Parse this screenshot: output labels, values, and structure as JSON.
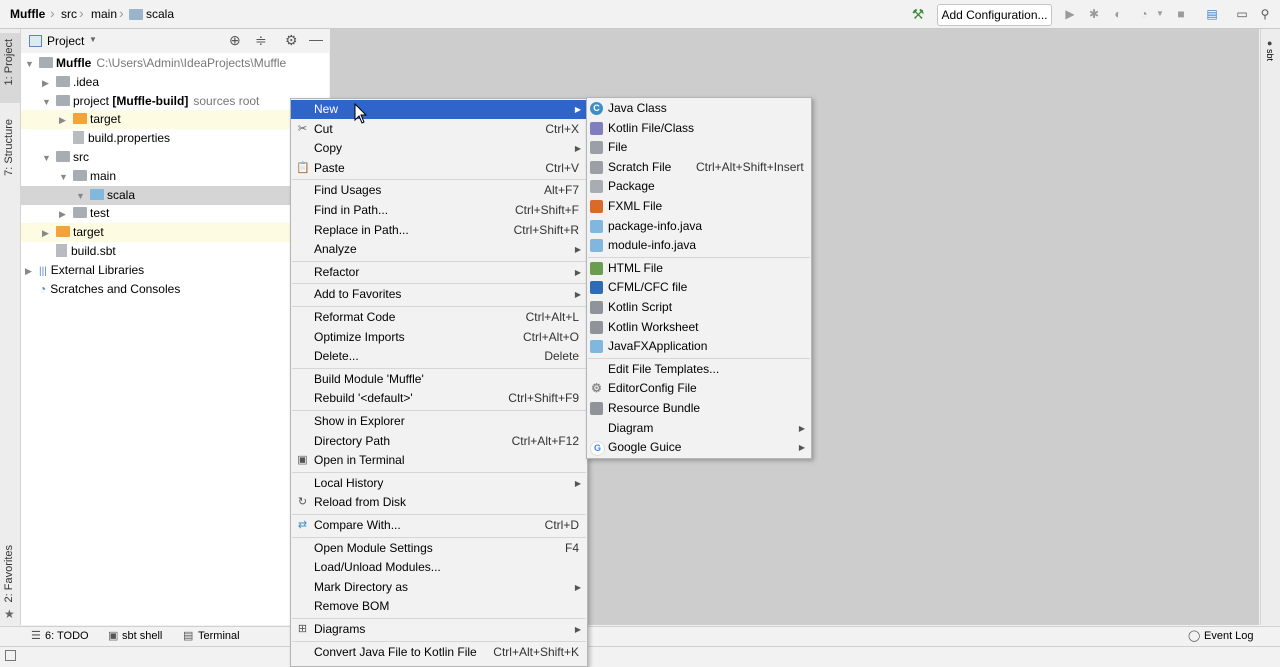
{
  "breadcrumbs": [
    "Muffle",
    "src",
    "main",
    "scala"
  ],
  "toolbar": {
    "add_configuration": "Add Configuration..."
  },
  "left_tabs": {
    "project": "1: Project",
    "structure": "7: Structure",
    "favorites": "2: Favorites"
  },
  "right_tabs": {
    "sbt": "sbt"
  },
  "project_panel": {
    "title": "Project",
    "tree": [
      {
        "label": "Muffle",
        "extra": "C:\\Users\\Admin\\IdeaProjects\\Muffle",
        "depth": 0,
        "icon": "grey",
        "arrow": "down",
        "bold": true
      },
      {
        "label": ".idea",
        "extra": "",
        "depth": 1,
        "icon": "grey",
        "arrow": "right",
        "bold": false
      },
      {
        "label": "project",
        "bold_part": "[Muffle-build]",
        "extra": "sources root",
        "depth": 1,
        "icon": "grey",
        "arrow": "down",
        "bold": false
      },
      {
        "label": "target",
        "extra": "",
        "depth": 2,
        "icon": "orange",
        "arrow": "right",
        "bold": false,
        "highlight": true
      },
      {
        "label": "build.properties",
        "extra": "",
        "depth": 2,
        "icon": "file",
        "arrow": "",
        "bold": false
      },
      {
        "label": "src",
        "extra": "",
        "depth": 1,
        "icon": "grey",
        "arrow": "down",
        "bold": false
      },
      {
        "label": "main",
        "extra": "",
        "depth": 2,
        "icon": "grey",
        "arrow": "down",
        "bold": false
      },
      {
        "label": "scala",
        "extra": "",
        "depth": 3,
        "icon": "blue",
        "arrow": "down",
        "bold": false,
        "selected": true
      },
      {
        "label": "test",
        "extra": "",
        "depth": 2,
        "icon": "grey",
        "arrow": "right",
        "bold": false
      },
      {
        "label": "target",
        "extra": "",
        "depth": 1,
        "icon": "orange",
        "arrow": "right",
        "bold": false,
        "highlight": true
      },
      {
        "label": "build.sbt",
        "extra": "",
        "depth": 1,
        "icon": "file",
        "arrow": "",
        "bold": false
      },
      {
        "label": "External Libraries",
        "extra": "",
        "depth": 0,
        "icon": "lib",
        "arrow": "right",
        "bold": false
      },
      {
        "label": "Scratches and Consoles",
        "extra": "",
        "depth": 0,
        "icon": "scratch",
        "arrow": "",
        "bold": false
      }
    ]
  },
  "context_menu": {
    "items": [
      {
        "label": "New",
        "shortcut": "",
        "submenu": true,
        "selected": true,
        "icon": ""
      },
      {
        "label": "Cut",
        "shortcut": "Ctrl+X",
        "icon": "scissors"
      },
      {
        "label": "Copy",
        "shortcut": "",
        "submenu": true,
        "icon": ""
      },
      {
        "label": "Paste",
        "shortcut": "Ctrl+V",
        "icon": "clipboard"
      },
      {
        "label": "Find Usages",
        "shortcut": "Alt+F7",
        "sep_before": true,
        "icon": ""
      },
      {
        "label": "Find in Path...",
        "shortcut": "Ctrl+Shift+F",
        "icon": ""
      },
      {
        "label": "Replace in Path...",
        "shortcut": "Ctrl+Shift+R",
        "icon": ""
      },
      {
        "label": "Analyze",
        "shortcut": "",
        "submenu": true,
        "icon": ""
      },
      {
        "label": "Refactor",
        "shortcut": "",
        "submenu": true,
        "sep_before": true,
        "icon": ""
      },
      {
        "label": "Add to Favorites",
        "shortcut": "",
        "submenu": true,
        "sep_before": true,
        "icon": ""
      },
      {
        "label": "Reformat Code",
        "shortcut": "Ctrl+Alt+L",
        "sep_before": true,
        "icon": ""
      },
      {
        "label": "Optimize Imports",
        "shortcut": "Ctrl+Alt+O",
        "icon": ""
      },
      {
        "label": "Delete...",
        "shortcut": "Delete",
        "icon": ""
      },
      {
        "label": "Build Module 'Muffle'",
        "shortcut": "",
        "sep_before": true,
        "icon": ""
      },
      {
        "label": "Rebuild '<default>'",
        "shortcut": "Ctrl+Shift+F9",
        "icon": ""
      },
      {
        "label": "Show in Explorer",
        "shortcut": "",
        "sep_before": true,
        "icon": ""
      },
      {
        "label": "Directory Path",
        "shortcut": "Ctrl+Alt+F12",
        "icon": ""
      },
      {
        "label": "Open in Terminal",
        "shortcut": "",
        "icon": "terminal"
      },
      {
        "label": "Local History",
        "shortcut": "",
        "submenu": true,
        "sep_before": true,
        "icon": ""
      },
      {
        "label": "Reload from Disk",
        "shortcut": "",
        "icon": "reload"
      },
      {
        "label": "Compare With...",
        "shortcut": "Ctrl+D",
        "sep_before": true,
        "icon": "compare"
      },
      {
        "label": "Open Module Settings",
        "shortcut": "F4",
        "sep_before": true,
        "icon": ""
      },
      {
        "label": "Load/Unload Modules...",
        "shortcut": "",
        "icon": ""
      },
      {
        "label": "Mark Directory as",
        "shortcut": "",
        "submenu": true,
        "icon": ""
      },
      {
        "label": "Remove BOM",
        "shortcut": "",
        "icon": ""
      },
      {
        "label": "Diagrams",
        "shortcut": "",
        "submenu": true,
        "sep_before": true,
        "icon": "diagram"
      },
      {
        "label": "Convert Java File to Kotlin File",
        "shortcut": "Ctrl+Alt+Shift+K",
        "sep_before": true,
        "icon": ""
      }
    ]
  },
  "new_submenu": {
    "items": [
      {
        "label": "Java Class",
        "shortcut": "",
        "icon": "c",
        "color": "#3d8fc6"
      },
      {
        "label": "Kotlin File/Class",
        "shortcut": "",
        "icon": "k",
        "color": "#7f7fbe"
      },
      {
        "label": "File",
        "shortcut": "",
        "icon": "f",
        "color": "#9aa0a6"
      },
      {
        "label": "Scratch File",
        "shortcut": "Ctrl+Alt+Shift+Insert",
        "icon": "s",
        "color": "#9aa0a6"
      },
      {
        "label": "Package",
        "shortcut": "",
        "icon": "p",
        "color": "#a8adb3"
      },
      {
        "label": "FXML File",
        "shortcut": "",
        "icon": "x",
        "color": "#d86a2c"
      },
      {
        "label": "package-info.java",
        "shortcut": "",
        "icon": "j",
        "color": "#7fb7dd"
      },
      {
        "label": "module-info.java",
        "shortcut": "",
        "icon": "j",
        "color": "#7fb7dd"
      },
      {
        "label": "HTML File",
        "shortcut": "",
        "sep_before": true,
        "icon": "h",
        "color": "#6a9e4f"
      },
      {
        "label": "CFML/CFC file",
        "shortcut": "",
        "icon": "cf",
        "color": "#2e6cb5"
      },
      {
        "label": "Kotlin Script",
        "shortcut": "",
        "icon": "k",
        "color": "#8e949a"
      },
      {
        "label": "Kotlin Worksheet",
        "shortcut": "",
        "icon": "k",
        "color": "#8e949a"
      },
      {
        "label": "JavaFXApplication",
        "shortcut": "",
        "icon": "j",
        "color": "#7fb7dd"
      },
      {
        "label": "Edit File Templates...",
        "shortcut": "",
        "sep_before": true,
        "icon": ""
      },
      {
        "label": "EditorConfig File",
        "shortcut": "",
        "icon": "gear",
        "color": "#9aa0a6"
      },
      {
        "label": "Resource Bundle",
        "shortcut": "",
        "icon": "r",
        "color": "#8e949a"
      },
      {
        "label": "Diagram",
        "shortcut": "",
        "submenu": true,
        "icon": ""
      },
      {
        "label": "Google Guice",
        "shortcut": "",
        "submenu": true,
        "icon": "g",
        "color": "#4285f4"
      }
    ]
  },
  "bottom_tabs": {
    "todo": "6: TODO",
    "sbt_shell": "sbt shell",
    "terminal": "Terminal",
    "event_log": "Event Log"
  }
}
